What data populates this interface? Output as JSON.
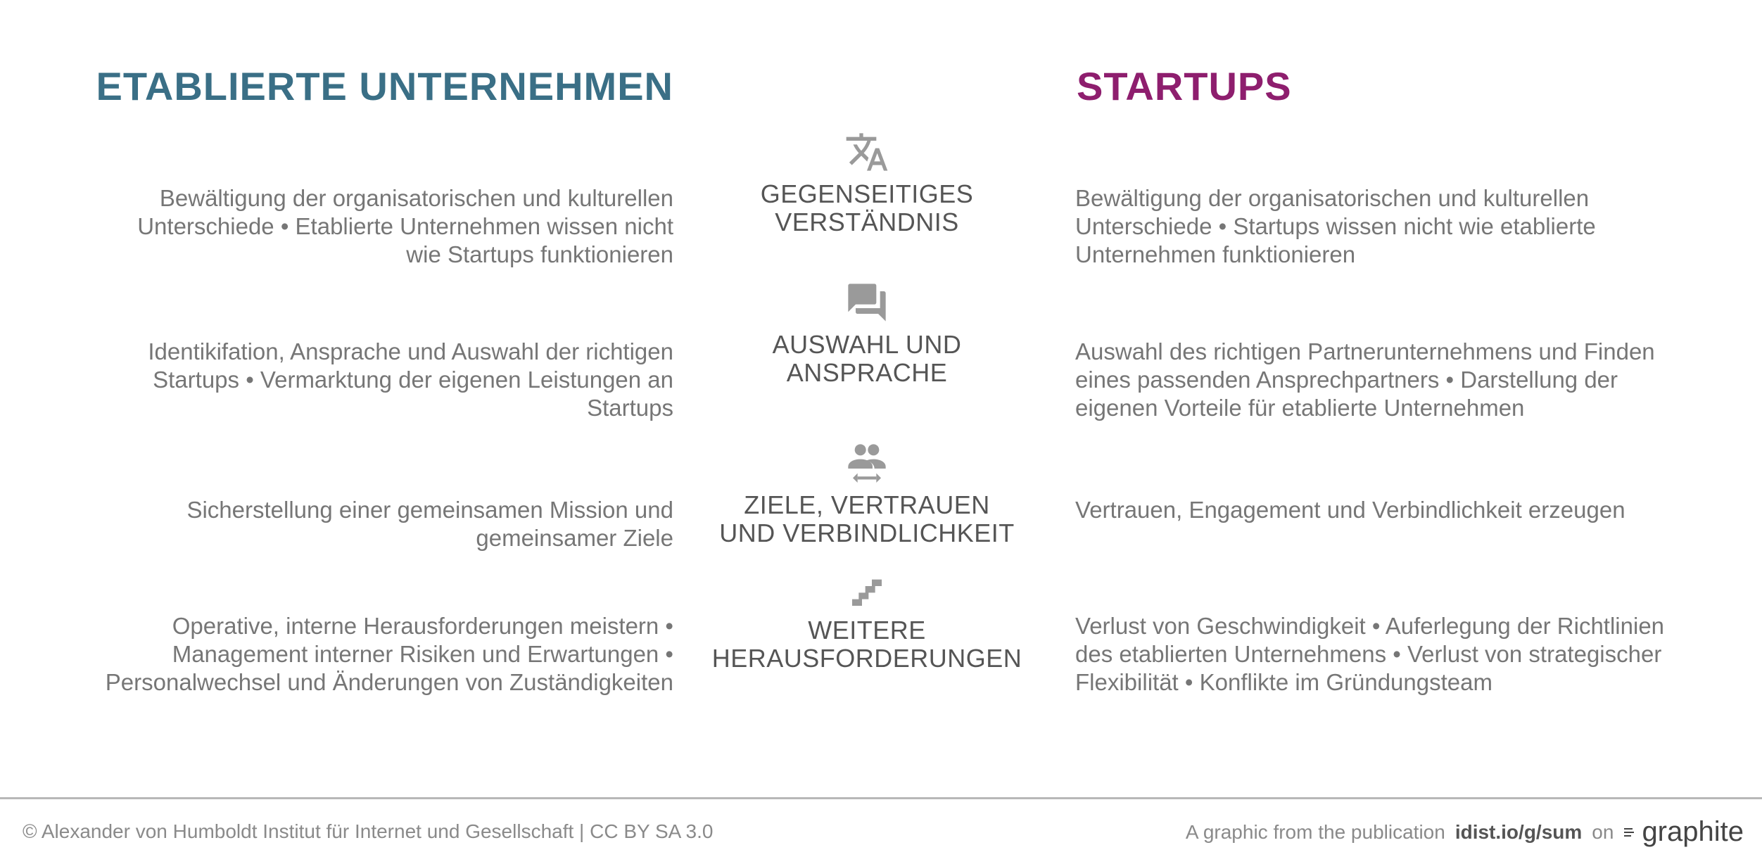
{
  "headers": {
    "left": "ETABLIERTE UNTERNEHMEN",
    "right": "STARTUPS"
  },
  "rows": [
    {
      "icon": "translate-icon",
      "title_line1": "GEGENSEITIGES",
      "title_line2": "VERSTÄNDNIS",
      "left": "Bewältigung der organisatorischen und kulturellen Unterschiede • Etablierte Unternehmen wissen nicht wie Startups funktionieren",
      "right": "Bewältigung der organisatorischen und kulturellen Unterschiede • Startups wissen nicht wie etablierte Unternehmen funktionieren"
    },
    {
      "icon": "chat-bubbles-icon",
      "title_line1": "AUSWAHL UND",
      "title_line2": "ANSPRACHE",
      "left": "Identikifation, Ansprache und Auswahl der richtigen Startups • Vermarktung der eigenen Leistungen an Startups",
      "right": "Auswahl des richtigen Partnerunternehmens und Finden eines passenden Ansprechpartners • Darstellung der eigenen Vorteile für etablierte Unternehmen"
    },
    {
      "icon": "people-exchange-icon",
      "title_line1": "ZIELE, VERTRAUEN",
      "title_line2": "UND VERBINDLICHKEIT",
      "left": "Sicherstellung einer gemeinsamen Mission und gemeinsamer Ziele",
      "right": "Vertrauen, Engagement und Verbindlichkeit erzeugen"
    },
    {
      "icon": "stairs-icon",
      "title_line1": "WEITERE",
      "title_line2": "HERAUSFORDERUNGEN",
      "left": "Operative, interne Herausforderungen meistern • Management interner Risiken und Erwartungen • Personalwechsel und Änderungen von Zuständigkeiten",
      "right": "Verlust von Geschwindigkeit • Auferlegung der Richtlinien des etablierten Unternehmens • Verlust von strategischer Flexibilität • Konflikte im Gründungsteam"
    }
  ],
  "footer": {
    "copyright": "© Alexander von Humboldt Institut für Internet und Gesellschaft | CC BY SA 3.0",
    "publication_prefix": "A graphic from the publication",
    "publication_link": "idist.io/g/sum",
    "on_text": "on",
    "brand": "graphite"
  },
  "colors": {
    "left_heading": "#3a6f86",
    "right_heading": "#8e1e6e",
    "body_text": "#767676",
    "icon": "#9a9a9a"
  }
}
